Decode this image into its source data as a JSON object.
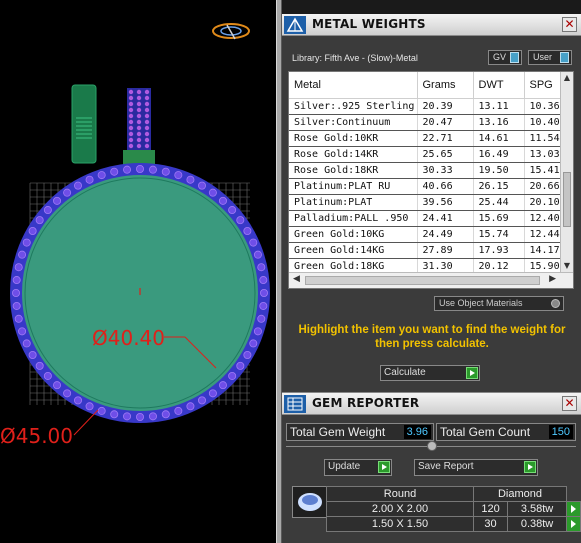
{
  "viewport": {
    "inner_dimension": "Ø40.40",
    "outer_dimension": "Ø45.00",
    "colors": {
      "ring_fill": "#3a9a7e",
      "gem_blue": "#3a3ad0",
      "dimension_red": "#e0201a",
      "grid": "#7a7a7a"
    }
  },
  "metal_weights": {
    "title": "METAL WEIGHTS",
    "library_label": "Library: Fifth Ave - (Slow)-Metal",
    "toggle_gv": "GV",
    "toggle_user": "User",
    "columns": [
      "Metal",
      "Grams",
      "DWT",
      "SPG"
    ],
    "rows": [
      [
        "Silver:.925 Sterling",
        "20.39",
        "13.11",
        "10.36"
      ],
      [
        "Silver:Continuum",
        "20.47",
        "13.16",
        "10.40"
      ],
      [
        "Rose Gold:10KR",
        "22.71",
        "14.61",
        "11.54"
      ],
      [
        "Rose Gold:14KR",
        "25.65",
        "16.49",
        "13.03"
      ],
      [
        "Rose Gold:18KR",
        "30.33",
        "19.50",
        "15.41"
      ],
      [
        "Platinum:PLAT RU",
        "40.66",
        "26.15",
        "20.66"
      ],
      [
        "Platinum:PLAT",
        "39.56",
        "25.44",
        "20.10"
      ],
      [
        "Palladium:PALL .950",
        "24.41",
        "15.69",
        "12.40"
      ],
      [
        "Green Gold:10KG",
        "24.49",
        "15.74",
        "12.44"
      ],
      [
        "Green Gold:14KG",
        "27.89",
        "17.93",
        "14.17"
      ],
      [
        "Green Gold:18KG",
        "31.30",
        "20.12",
        "15.90"
      ]
    ],
    "use_object_materials": "Use Object Materials",
    "instruction": "Highlight the item you want to find the weight for then press calculate.",
    "calculate_label": "Calculate"
  },
  "gem_reporter": {
    "title": "GEM REPORTER",
    "total_gem_weight_label": "Total Gem Weight",
    "total_gem_weight": "3.96",
    "total_gem_count_label": "Total Gem Count",
    "total_gem_count": "150",
    "update_label": "Update",
    "save_report_label": "Save Report",
    "table_headers": [
      "Round",
      "Diamond"
    ],
    "gems": [
      {
        "size": "2.00 X 2.00",
        "count": "120",
        "weight": "3.58tw"
      },
      {
        "size": "1.50 X 1.50",
        "count": "30",
        "weight": "0.38tw"
      }
    ]
  }
}
